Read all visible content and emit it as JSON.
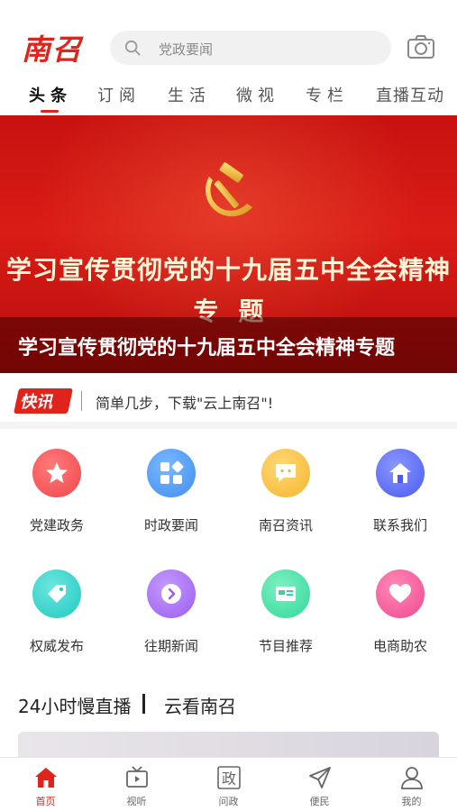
{
  "header": {
    "logo_text": "南召",
    "search_placeholder": "党政要闻"
  },
  "tabs": [
    {
      "label": "头条",
      "active": true
    },
    {
      "label": "订阅",
      "active": false
    },
    {
      "label": "生活",
      "active": false
    },
    {
      "label": "微视",
      "active": false
    },
    {
      "label": "专栏",
      "active": false
    },
    {
      "label": "直播互动",
      "active": false
    }
  ],
  "banner": {
    "title": "学习宣传贯彻党的十九届五中全会精神",
    "subtitle": "专题",
    "caption": "学习宣传贯彻党的十九届五中全会精神专题"
  },
  "flash": {
    "badge": "快讯",
    "text": "简单几步，下载\"云上南召\"!"
  },
  "grid": [
    {
      "label": "党建政务",
      "icon": "star-icon",
      "color": "#f0474a"
    },
    {
      "label": "时政要闻",
      "icon": "apps-icon",
      "color": "#3f8ef0"
    },
    {
      "label": "南召资讯",
      "icon": "chat-icon",
      "color": "#f5b52a"
    },
    {
      "label": "联系我们",
      "icon": "home-icon",
      "color": "#4a5cf0"
    },
    {
      "label": "权威发布",
      "icon": "tag-icon",
      "color": "#21c9c0"
    },
    {
      "label": "往期新闻",
      "icon": "arrow-right-icon",
      "color": "#9c5cf0"
    },
    {
      "label": "节目推荐",
      "icon": "card-icon",
      "color": "#2fd89a"
    },
    {
      "label": "电商助农",
      "icon": "heart-icon",
      "color": "#f0478e"
    }
  ],
  "live": {
    "title": "24小时慢直播",
    "subtitle": "云看南召"
  },
  "bottom_nav": [
    {
      "label": "首页",
      "icon": "home-icon",
      "active": true
    },
    {
      "label": "视听",
      "icon": "tv-icon",
      "active": false
    },
    {
      "label": "问政",
      "icon": "zheng-icon",
      "glyph": "政",
      "active": false
    },
    {
      "label": "便民",
      "icon": "send-icon",
      "active": false
    },
    {
      "label": "我的",
      "icon": "user-icon",
      "active": false
    }
  ],
  "colors": {
    "accent": "#e0241b",
    "banner_red": "#c8120f"
  }
}
